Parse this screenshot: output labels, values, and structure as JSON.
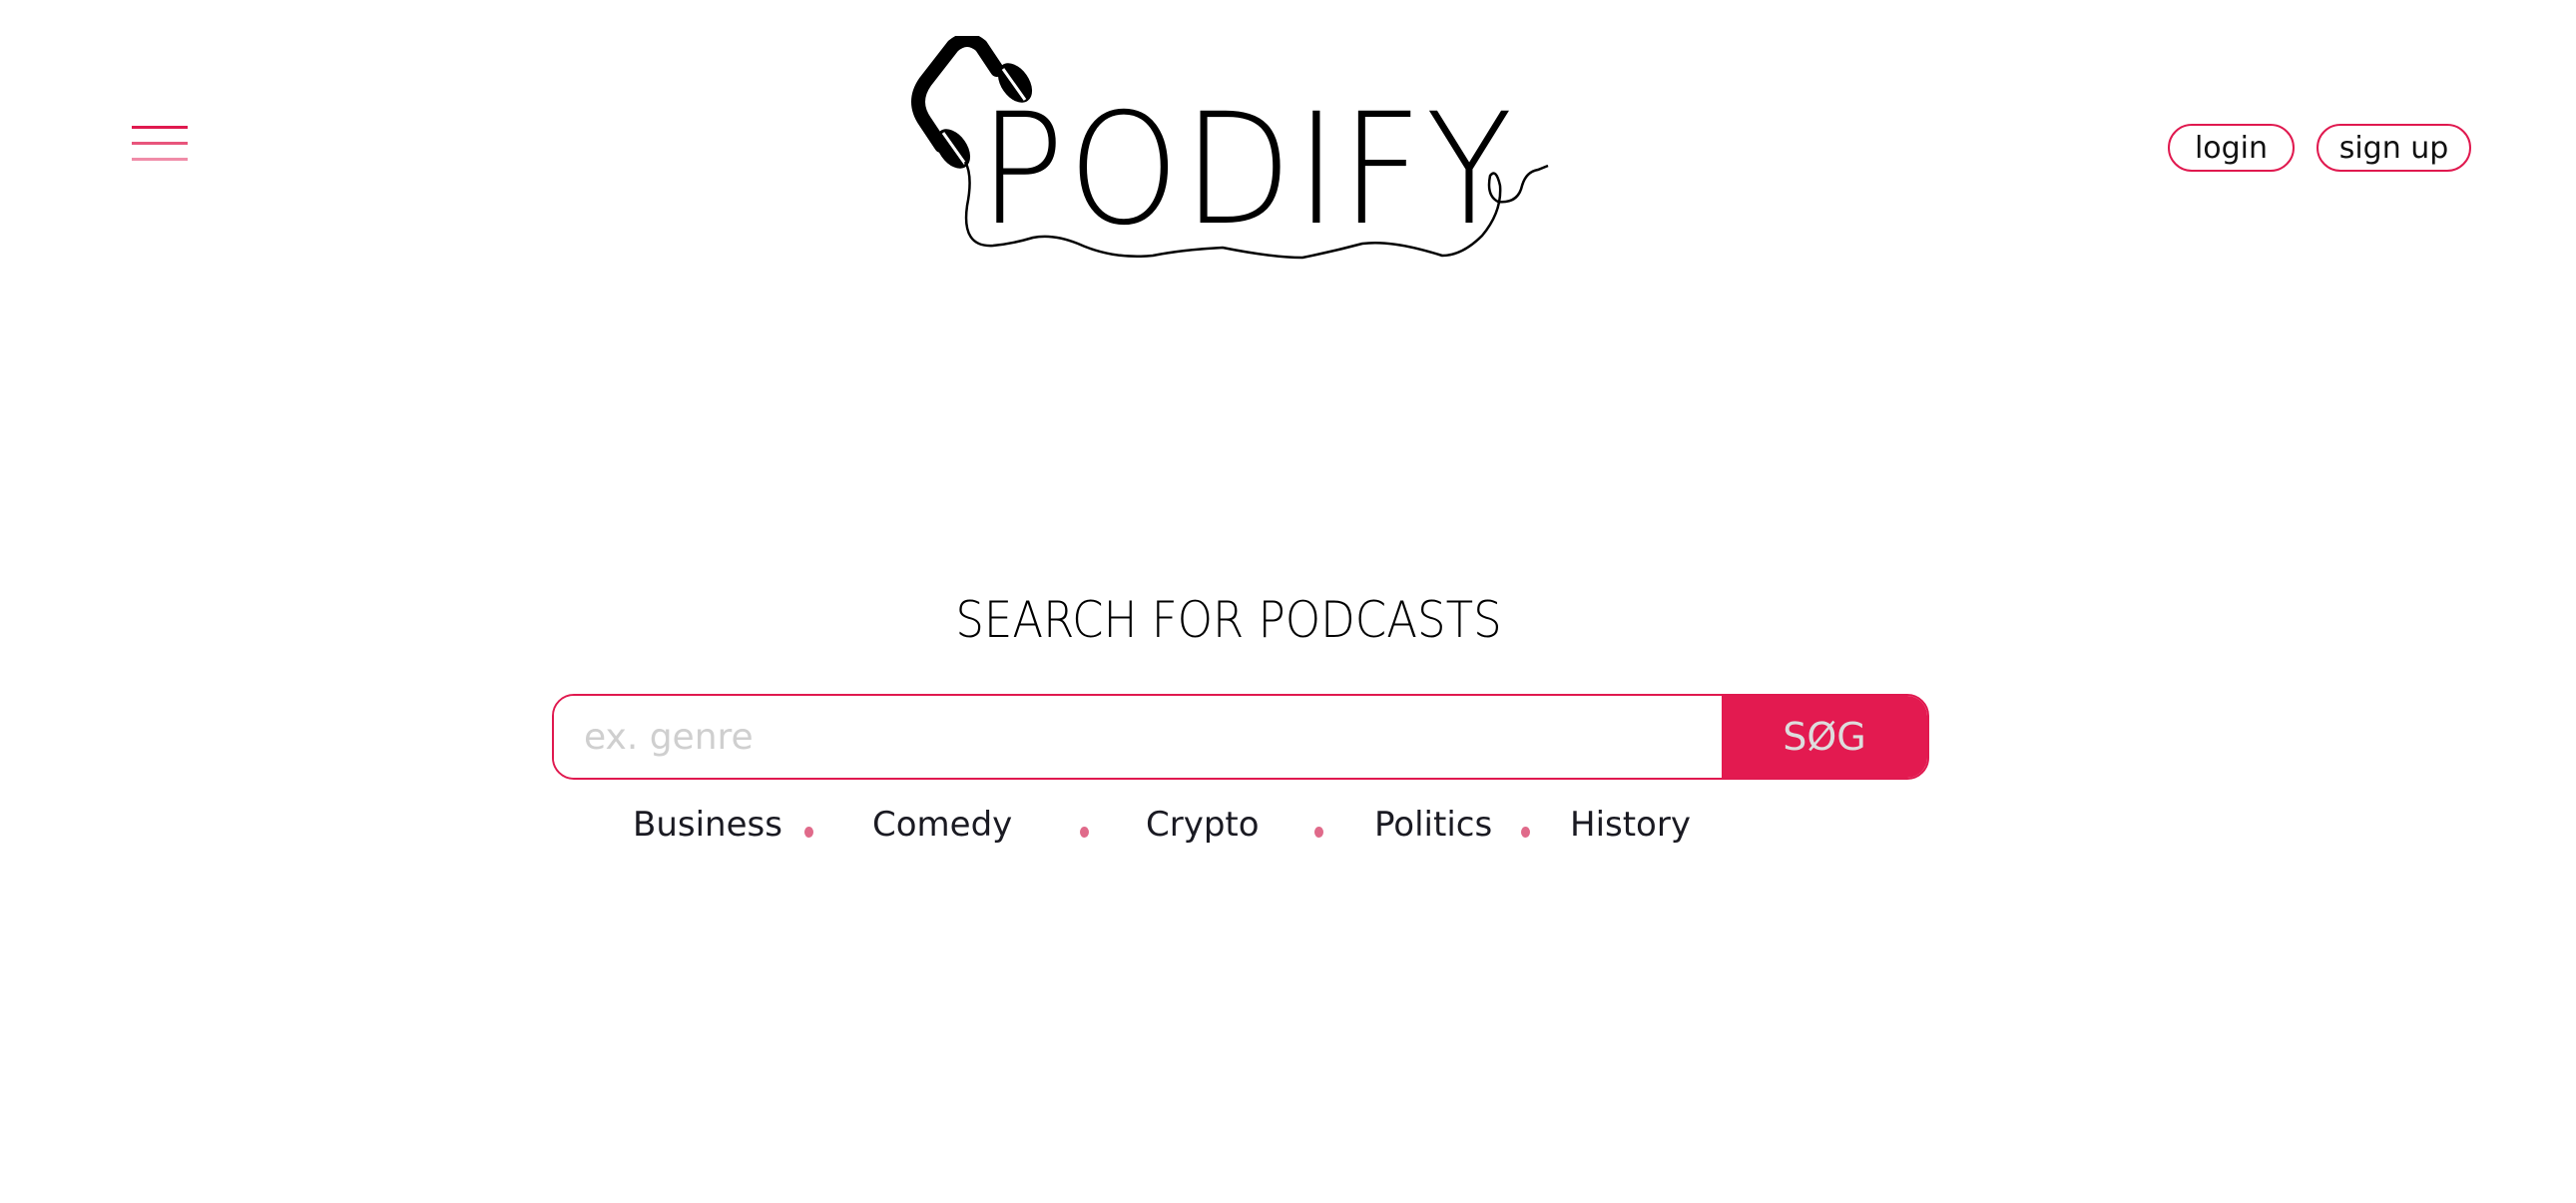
{
  "header": {
    "logo_text": "PODIFY",
    "menu_icon": "hamburger-icon",
    "login_label": "login",
    "signup_label": "sign up"
  },
  "main": {
    "title": "SEARCH FOR PODCASTS",
    "search_placeholder": "ex. genre",
    "search_value": "",
    "search_button": "SØG",
    "categories": [
      "Business",
      "Comedy",
      "Crypto",
      "Politics",
      "History"
    ]
  },
  "colors": {
    "accent": "#e31a50",
    "placeholder": "#cfcfcf"
  }
}
